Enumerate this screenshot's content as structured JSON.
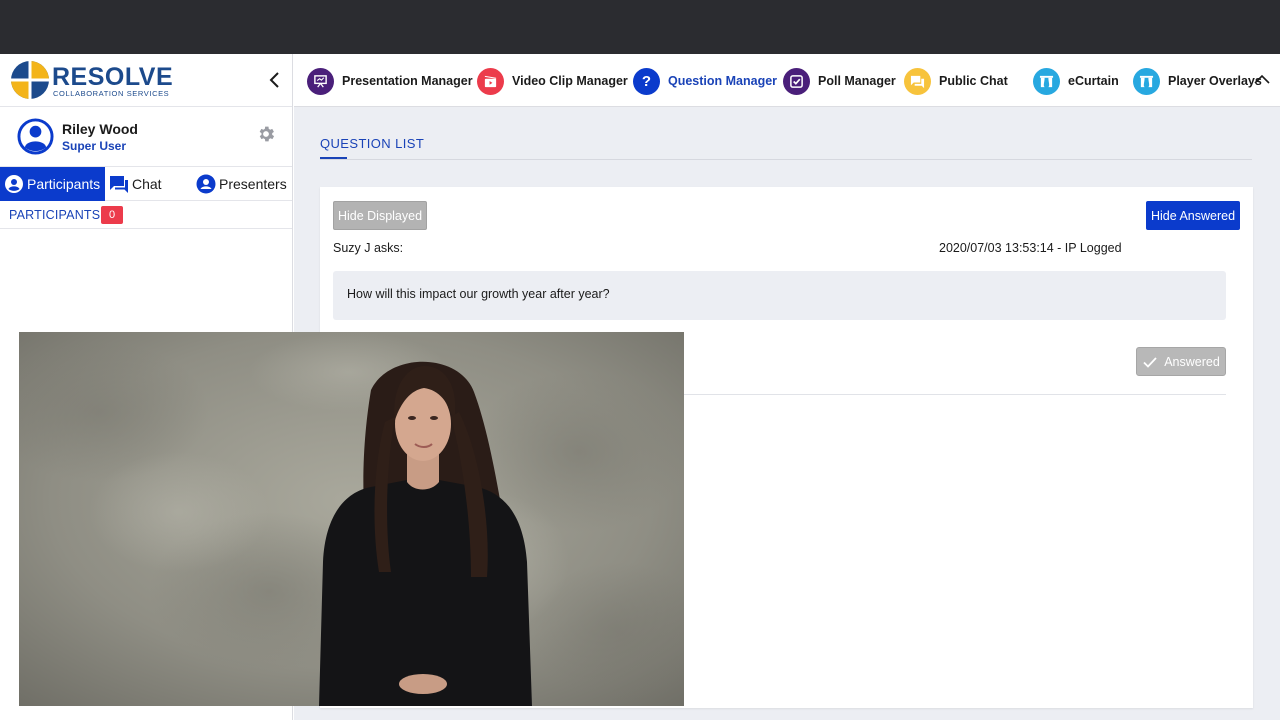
{
  "sidebar": {
    "logo": {
      "title": "RESOLVE",
      "subtitle": "COLLABORATION SERVICES"
    },
    "user": {
      "name": "Riley Wood",
      "role": "Super User"
    },
    "tabs": [
      {
        "label": "Participants",
        "icon": "person-icon",
        "active": true
      },
      {
        "label": "Chat",
        "icon": "chat-icon",
        "active": false
      },
      {
        "label": "Presenters",
        "icon": "person-icon",
        "active": false
      }
    ],
    "participants": {
      "label": "PARTICIPANTS",
      "count": "0"
    }
  },
  "navbar": {
    "items": [
      {
        "label": "Presentation Manager",
        "icon": "presentation-icon",
        "color": "#4a1f7a"
      },
      {
        "label": "Video Clip Manager",
        "icon": "video-clip-icon",
        "color": "#ec3b4b"
      },
      {
        "label": "Question Manager",
        "icon": "question-icon",
        "color": "#0b3bcc",
        "active": true
      },
      {
        "label": "Poll Manager",
        "icon": "checkbox-icon",
        "color": "#4a1f7a"
      },
      {
        "label": "Public Chat",
        "icon": "chat-bubbles-icon",
        "color": "#f7c33c"
      },
      {
        "label": "eCurtain",
        "icon": "curtain-icon",
        "color": "#27a8e0"
      },
      {
        "label": "Player Overlays",
        "icon": "curtain-icon",
        "color": "#27a8e0"
      }
    ]
  },
  "main": {
    "section_tab": "QUESTION LIST",
    "hide_displayed": "Hide Displayed",
    "hide_answered": "Hide Answered",
    "question": {
      "asker": "Suzy J asks:",
      "timestamp": "2020/07/03 13:53:14 - IP Logged",
      "text": "How will this impact our growth year after year?",
      "answered_label": "Answered"
    }
  },
  "colors": {
    "accent": "#0b3bcc",
    "topbar": "#2b2c30",
    "badge": "#ec3b4b",
    "background": "#eceef3"
  }
}
